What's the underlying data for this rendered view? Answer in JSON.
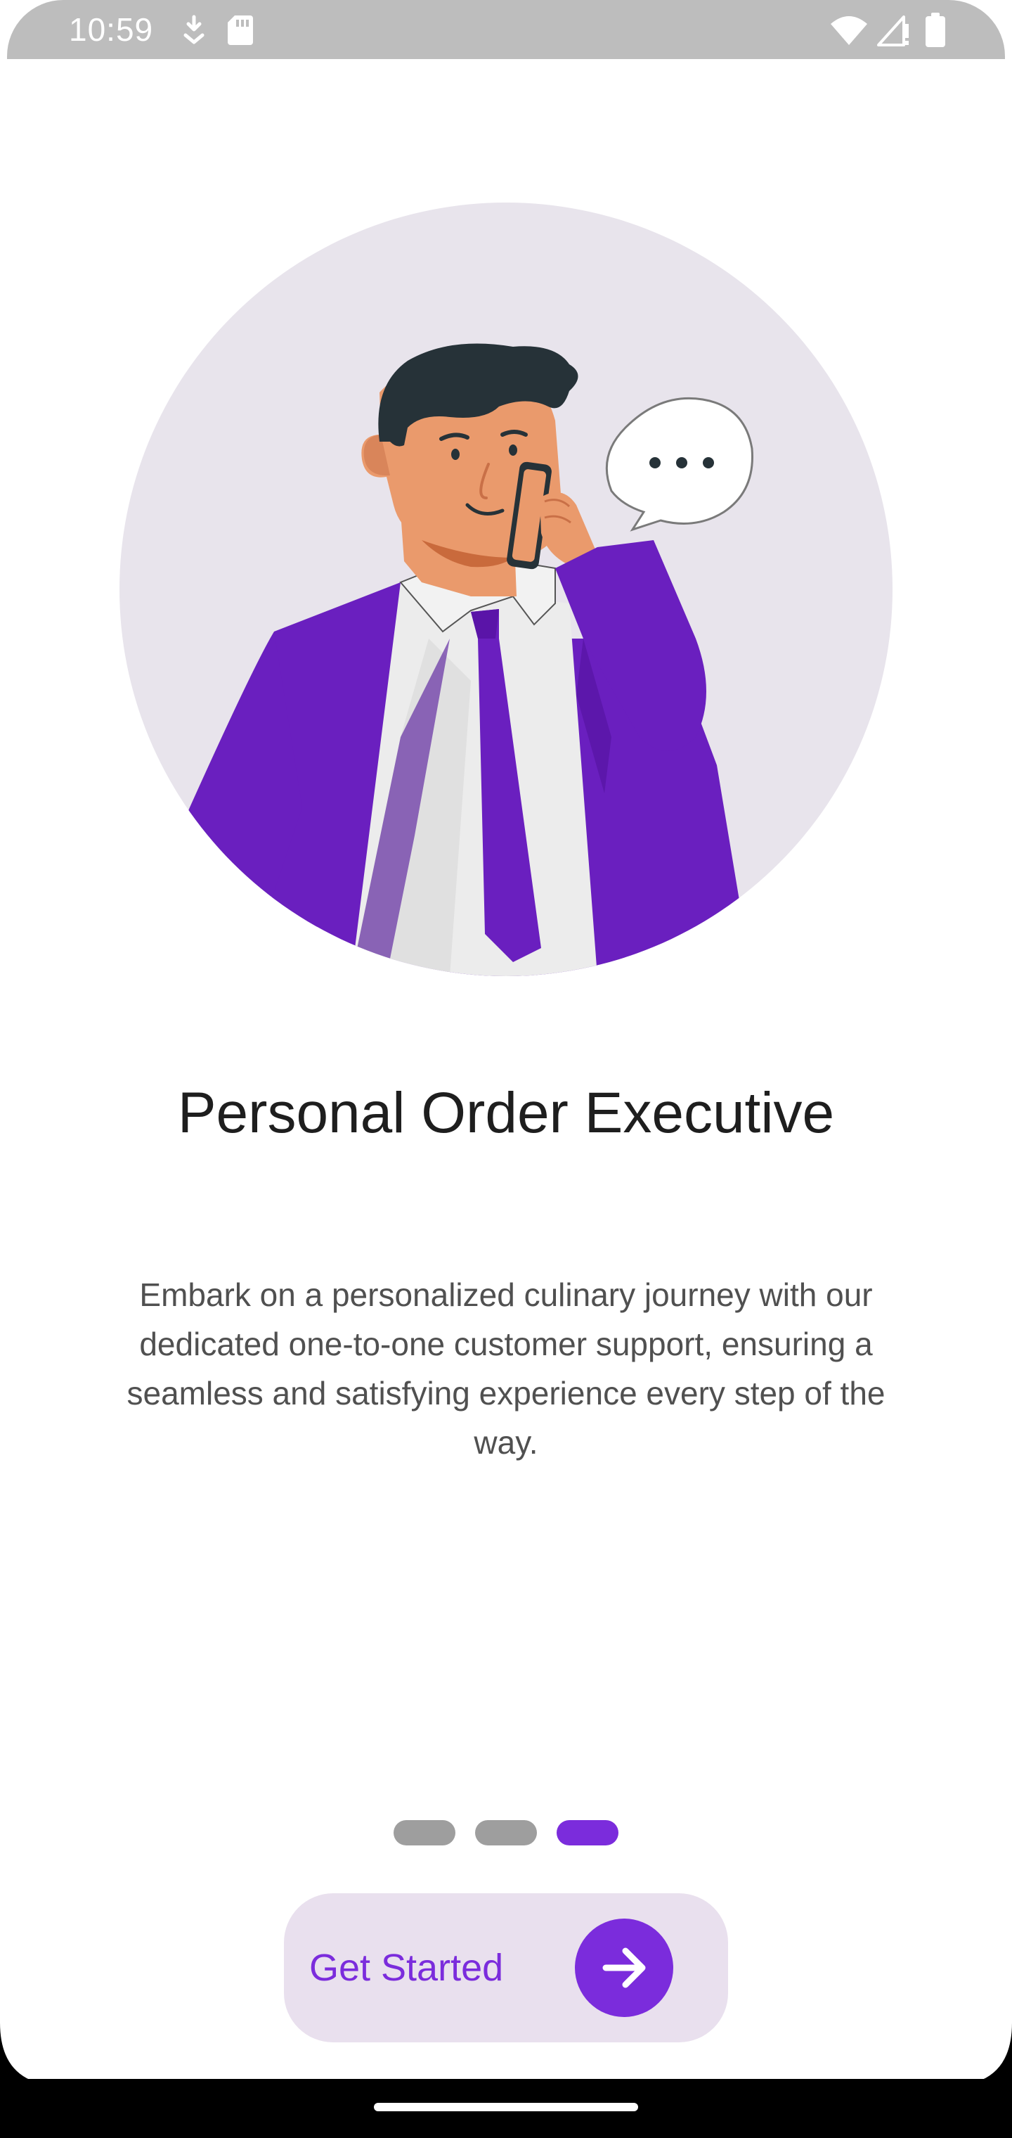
{
  "status_bar": {
    "time": "10:59",
    "icons_left": [
      "download-icon",
      "sd-card-icon"
    ],
    "icons_right": [
      "wifi-icon",
      "signal-icon",
      "battery-icon"
    ]
  },
  "illustration": {
    "icon": "support-agent-illustration",
    "chat_bubble": "speech-bubble-icon"
  },
  "content": {
    "title": "Personal Order Executive",
    "description": "Embark on a personalized culinary journey with our dedicated one-to-one customer support, ensuring a seamless and satisfying experience every step of the way."
  },
  "pagination": {
    "total": 3,
    "active_index": 2
  },
  "cta": {
    "label": "Get Started",
    "icon": "arrow-right-icon"
  },
  "colors": {
    "accent": "#7b2cdc",
    "suit": "#6a1fbf",
    "circle_bg": "#e8e4ec",
    "button_bg": "#e9e0ee"
  }
}
